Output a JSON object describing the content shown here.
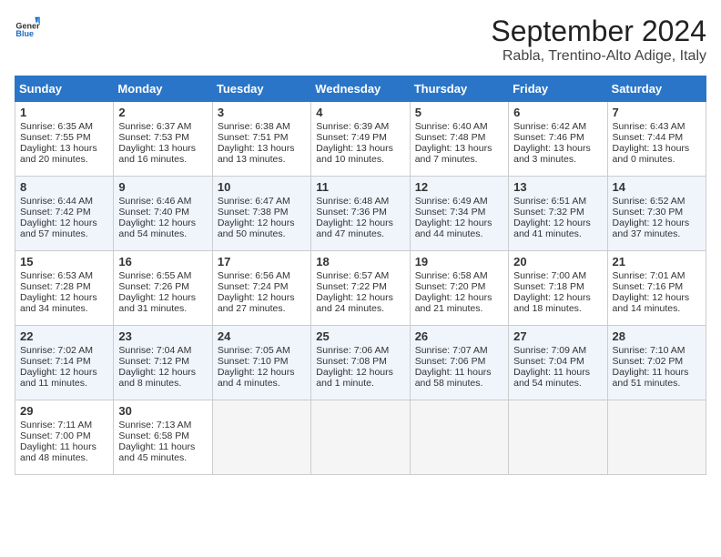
{
  "header": {
    "logo_text_general": "General",
    "logo_text_blue": "Blue",
    "month_title": "September 2024",
    "subtitle": "Rabla, Trentino-Alto Adige, Italy"
  },
  "days_of_week": [
    "Sunday",
    "Monday",
    "Tuesday",
    "Wednesday",
    "Thursday",
    "Friday",
    "Saturday"
  ],
  "weeks": [
    [
      {
        "day": "1",
        "lines": [
          "Sunrise: 6:35 AM",
          "Sunset: 7:55 PM",
          "Daylight: 13 hours",
          "and 20 minutes."
        ]
      },
      {
        "day": "2",
        "lines": [
          "Sunrise: 6:37 AM",
          "Sunset: 7:53 PM",
          "Daylight: 13 hours",
          "and 16 minutes."
        ]
      },
      {
        "day": "3",
        "lines": [
          "Sunrise: 6:38 AM",
          "Sunset: 7:51 PM",
          "Daylight: 13 hours",
          "and 13 minutes."
        ]
      },
      {
        "day": "4",
        "lines": [
          "Sunrise: 6:39 AM",
          "Sunset: 7:49 PM",
          "Daylight: 13 hours",
          "and 10 minutes."
        ]
      },
      {
        "day": "5",
        "lines": [
          "Sunrise: 6:40 AM",
          "Sunset: 7:48 PM",
          "Daylight: 13 hours",
          "and 7 minutes."
        ]
      },
      {
        "day": "6",
        "lines": [
          "Sunrise: 6:42 AM",
          "Sunset: 7:46 PM",
          "Daylight: 13 hours",
          "and 3 minutes."
        ]
      },
      {
        "day": "7",
        "lines": [
          "Sunrise: 6:43 AM",
          "Sunset: 7:44 PM",
          "Daylight: 13 hours",
          "and 0 minutes."
        ]
      }
    ],
    [
      {
        "day": "8",
        "lines": [
          "Sunrise: 6:44 AM",
          "Sunset: 7:42 PM",
          "Daylight: 12 hours",
          "and 57 minutes."
        ]
      },
      {
        "day": "9",
        "lines": [
          "Sunrise: 6:46 AM",
          "Sunset: 7:40 PM",
          "Daylight: 12 hours",
          "and 54 minutes."
        ]
      },
      {
        "day": "10",
        "lines": [
          "Sunrise: 6:47 AM",
          "Sunset: 7:38 PM",
          "Daylight: 12 hours",
          "and 50 minutes."
        ]
      },
      {
        "day": "11",
        "lines": [
          "Sunrise: 6:48 AM",
          "Sunset: 7:36 PM",
          "Daylight: 12 hours",
          "and 47 minutes."
        ]
      },
      {
        "day": "12",
        "lines": [
          "Sunrise: 6:49 AM",
          "Sunset: 7:34 PM",
          "Daylight: 12 hours",
          "and 44 minutes."
        ]
      },
      {
        "day": "13",
        "lines": [
          "Sunrise: 6:51 AM",
          "Sunset: 7:32 PM",
          "Daylight: 12 hours",
          "and 41 minutes."
        ]
      },
      {
        "day": "14",
        "lines": [
          "Sunrise: 6:52 AM",
          "Sunset: 7:30 PM",
          "Daylight: 12 hours",
          "and 37 minutes."
        ]
      }
    ],
    [
      {
        "day": "15",
        "lines": [
          "Sunrise: 6:53 AM",
          "Sunset: 7:28 PM",
          "Daylight: 12 hours",
          "and 34 minutes."
        ]
      },
      {
        "day": "16",
        "lines": [
          "Sunrise: 6:55 AM",
          "Sunset: 7:26 PM",
          "Daylight: 12 hours",
          "and 31 minutes."
        ]
      },
      {
        "day": "17",
        "lines": [
          "Sunrise: 6:56 AM",
          "Sunset: 7:24 PM",
          "Daylight: 12 hours",
          "and 27 minutes."
        ]
      },
      {
        "day": "18",
        "lines": [
          "Sunrise: 6:57 AM",
          "Sunset: 7:22 PM",
          "Daylight: 12 hours",
          "and 24 minutes."
        ]
      },
      {
        "day": "19",
        "lines": [
          "Sunrise: 6:58 AM",
          "Sunset: 7:20 PM",
          "Daylight: 12 hours",
          "and 21 minutes."
        ]
      },
      {
        "day": "20",
        "lines": [
          "Sunrise: 7:00 AM",
          "Sunset: 7:18 PM",
          "Daylight: 12 hours",
          "and 18 minutes."
        ]
      },
      {
        "day": "21",
        "lines": [
          "Sunrise: 7:01 AM",
          "Sunset: 7:16 PM",
          "Daylight: 12 hours",
          "and 14 minutes."
        ]
      }
    ],
    [
      {
        "day": "22",
        "lines": [
          "Sunrise: 7:02 AM",
          "Sunset: 7:14 PM",
          "Daylight: 12 hours",
          "and 11 minutes."
        ]
      },
      {
        "day": "23",
        "lines": [
          "Sunrise: 7:04 AM",
          "Sunset: 7:12 PM",
          "Daylight: 12 hours",
          "and 8 minutes."
        ]
      },
      {
        "day": "24",
        "lines": [
          "Sunrise: 7:05 AM",
          "Sunset: 7:10 PM",
          "Daylight: 12 hours",
          "and 4 minutes."
        ]
      },
      {
        "day": "25",
        "lines": [
          "Sunrise: 7:06 AM",
          "Sunset: 7:08 PM",
          "Daylight: 12 hours",
          "and 1 minute."
        ]
      },
      {
        "day": "26",
        "lines": [
          "Sunrise: 7:07 AM",
          "Sunset: 7:06 PM",
          "Daylight: 11 hours",
          "and 58 minutes."
        ]
      },
      {
        "day": "27",
        "lines": [
          "Sunrise: 7:09 AM",
          "Sunset: 7:04 PM",
          "Daylight: 11 hours",
          "and 54 minutes."
        ]
      },
      {
        "day": "28",
        "lines": [
          "Sunrise: 7:10 AM",
          "Sunset: 7:02 PM",
          "Daylight: 11 hours",
          "and 51 minutes."
        ]
      }
    ],
    [
      {
        "day": "29",
        "lines": [
          "Sunrise: 7:11 AM",
          "Sunset: 7:00 PM",
          "Daylight: 11 hours",
          "and 48 minutes."
        ]
      },
      {
        "day": "30",
        "lines": [
          "Sunrise: 7:13 AM",
          "Sunset: 6:58 PM",
          "Daylight: 11 hours",
          "and 45 minutes."
        ]
      },
      {
        "day": "",
        "lines": []
      },
      {
        "day": "",
        "lines": []
      },
      {
        "day": "",
        "lines": []
      },
      {
        "day": "",
        "lines": []
      },
      {
        "day": "",
        "lines": []
      }
    ]
  ]
}
